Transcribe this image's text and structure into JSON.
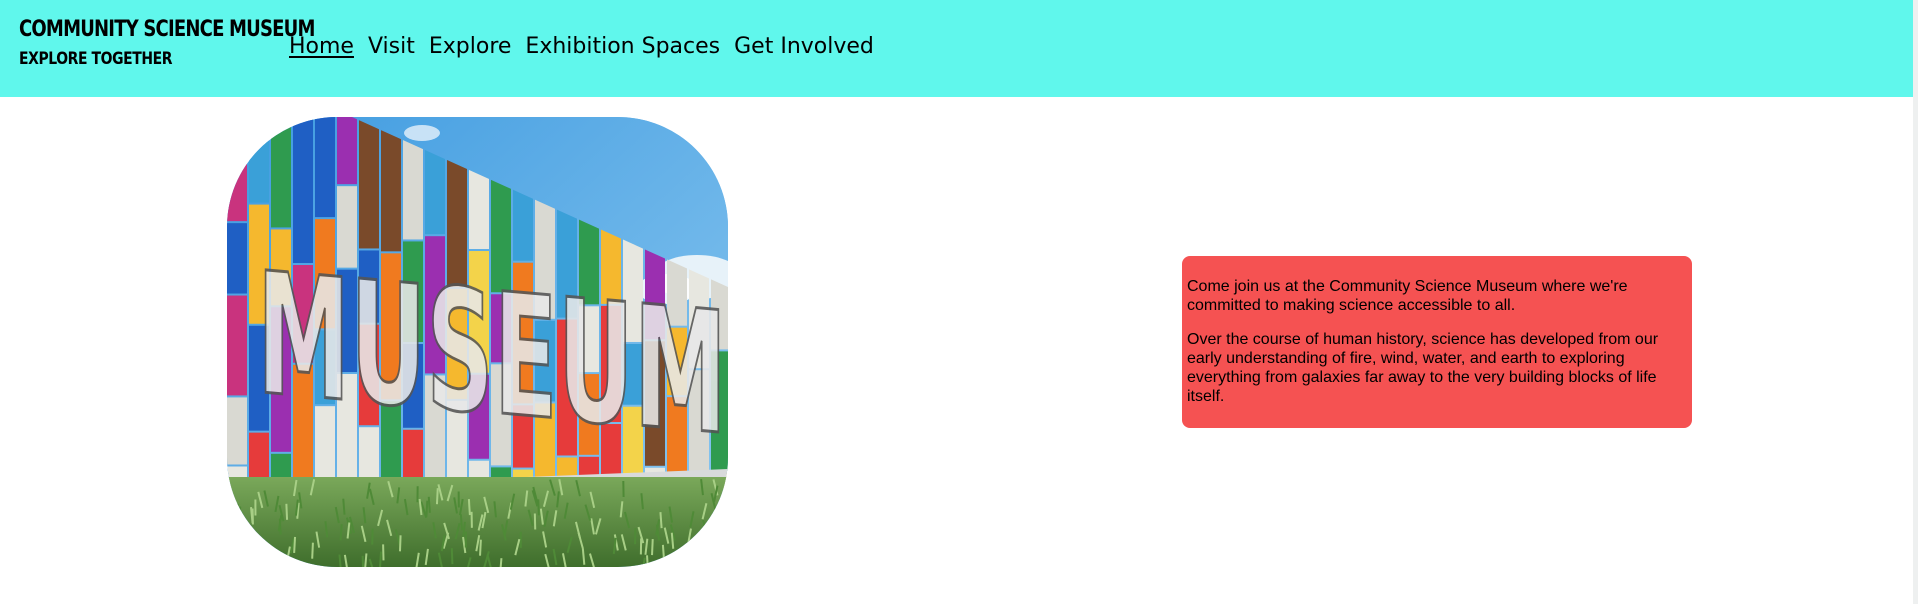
{
  "header": {
    "title": "COMMUNITY SCIENCE MUSEUM",
    "tagline": "EXPLORE TOGETHER",
    "background_color": "#60f7ec"
  },
  "nav": {
    "items": [
      {
        "label": "Home",
        "active": true
      },
      {
        "label": "Visit",
        "active": false
      },
      {
        "label": "Explore",
        "active": false
      },
      {
        "label": "Exhibition Spaces",
        "active": false
      },
      {
        "label": "Get Involved",
        "active": false
      }
    ]
  },
  "hero_image": {
    "sign_text": "MUSEUM"
  },
  "info_box": {
    "paragraphs": [
      "Come join us at the Community Science Museum where we're committed to making science accessible to all.",
      "Over the course of human history, science has developed from our early understanding of fire, wind, water, and earth to exploring everything from galaxies far away to the very building blocks of life itself."
    ],
    "background_color": "#f55252"
  }
}
